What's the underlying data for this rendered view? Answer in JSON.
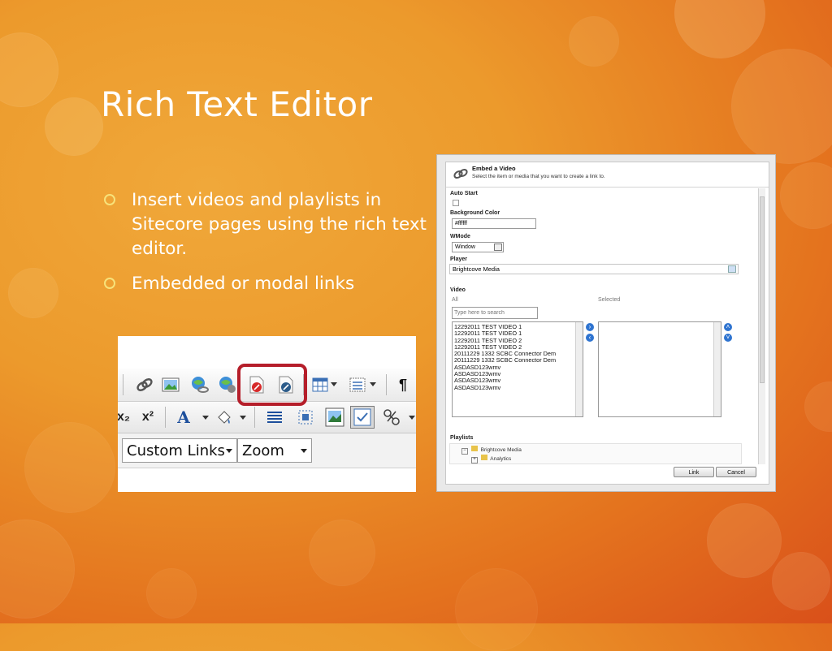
{
  "slide": {
    "title": "Rich Text Editor",
    "bullets": [
      "Insert videos and playlists in Sitecore pages using the rich text editor.",
      "Embedded or modal links"
    ]
  },
  "colors": {
    "background_light": "#f0a83a",
    "background_dark": "#d9501a",
    "bullet_ring": "#f7e27a",
    "highlight_border": "#b51e2a",
    "arrow_button": "#2f74d0"
  },
  "toolbar": {
    "font_size_dropdown": "Custom Links",
    "zoom_dropdown": "Zoom",
    "subscript_label": "x₂",
    "superscript_label": "x²",
    "font_color_label": "A",
    "paragraph_mark": "¶",
    "icons": [
      "hyperlink-icon",
      "image-icon",
      "link-manager-icon",
      "link-remove-icon",
      "embed-video-icon",
      "insert-video-link-icon",
      "table-icon",
      "list-icon",
      "paragraph-icon",
      "subscript-icon",
      "superscript-icon",
      "font-color-icon",
      "highlight-color-icon",
      "align-icon",
      "select-all-icon",
      "media-icon",
      "layout-icon",
      "settings-icon"
    ]
  },
  "dialog": {
    "title": "Embed a Video",
    "subtitle": "Select the item or media that you want to create a link to.",
    "auto_start_label": "Auto Start",
    "auto_start_checked": false,
    "background_color_label": "Background Color",
    "background_color_value": "#ffffff",
    "wmode_label": "WMode",
    "wmode_value": "Window",
    "player_label": "Player",
    "player_value": "Brightcove Media",
    "video_label": "Video",
    "all_label": "All",
    "selected_label": "Selected",
    "search_placeholder": "Type here to search",
    "videos": [
      "12292011 TEST VIDEO 1",
      "12292011 TEST VIDEO 1",
      "12292011 TEST VIDEO 2",
      "12292011 TEST VIDEO 2",
      "20111229 1332 SCBC Connector Dem",
      "20111229 1332 SCBC Connector Dem",
      "ASDASD123wmv",
      "ASDASD123wmv",
      "ASDASD123wmv",
      "ASDASD123wmv"
    ],
    "playlists_label": "Playlists",
    "playlist_tree": [
      "Brightcove Media",
      "Analytics"
    ],
    "link_button": "Link",
    "cancel_button": "Cancel"
  }
}
